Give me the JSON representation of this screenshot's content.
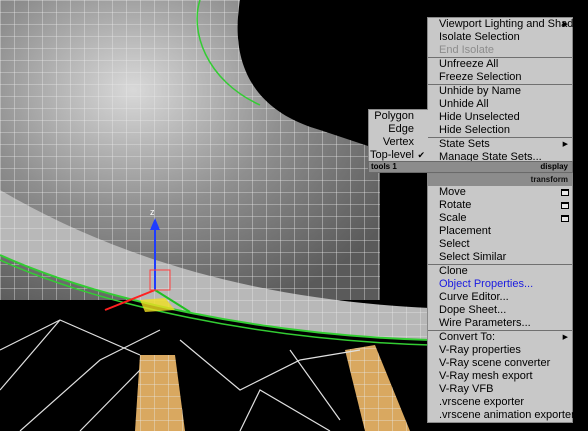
{
  "quad_top_right": {
    "items": [
      {
        "label": "Viewport Lighting and Shadows",
        "submenu": true
      },
      {
        "label": "Isolate Selection"
      },
      {
        "label": "End Isolate",
        "disabled": true
      },
      {
        "sep": true
      },
      {
        "label": "Unfreeze All"
      },
      {
        "label": "Freeze Selection"
      },
      {
        "sep": true
      },
      {
        "label": "Unhide by Name"
      },
      {
        "label": "Unhide All"
      },
      {
        "label": "Hide Unselected"
      },
      {
        "label": "Hide Selection"
      },
      {
        "sep": true
      },
      {
        "label": "State Sets",
        "submenu": true
      },
      {
        "label": "Manage State Sets..."
      }
    ]
  },
  "quad_top_left": {
    "items": [
      {
        "label": "Polygon"
      },
      {
        "label": "Edge"
      },
      {
        "label": "Vertex"
      },
      {
        "label": "Top-level",
        "checked": true
      }
    ]
  },
  "headers": {
    "tools1": "tools 1",
    "display": "display",
    "transform": "transform"
  },
  "quad_bottom": {
    "items": [
      {
        "label": "Move",
        "option_box": true
      },
      {
        "label": "Rotate",
        "option_box": true
      },
      {
        "label": "Scale",
        "option_box": true
      },
      {
        "label": "Placement"
      },
      {
        "label": "Select"
      },
      {
        "label": "Select Similar"
      },
      {
        "sep": true
      },
      {
        "label": "Clone"
      },
      {
        "label": "Object Properties...",
        "highlighted": true
      },
      {
        "label": "Curve Editor..."
      },
      {
        "label": "Dope Sheet..."
      },
      {
        "label": "Wire Parameters..."
      },
      {
        "sep": true
      },
      {
        "label": "Convert To:",
        "submenu": true
      },
      {
        "label": "V-Ray properties"
      },
      {
        "label": "V-Ray scene converter"
      },
      {
        "label": "V-Ray mesh export"
      },
      {
        "label": "V-Ray VFB"
      },
      {
        "label": ".vrscene exporter"
      },
      {
        "label": ".vrscene animation exporter"
      }
    ]
  },
  "colors": {
    "menu_bg": "#c8c8c8",
    "header_bg": "#8c8c8c",
    "highlight_text": "#1a1ae0",
    "selection_edge": "#33cc33"
  }
}
